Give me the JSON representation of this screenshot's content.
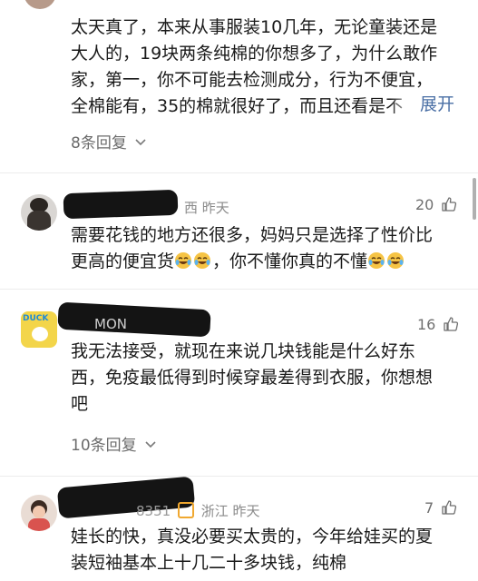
{
  "comment0": {
    "lines": [
      "太天真了，本来从事服装10几年，无论童装还是",
      "大人的，19块两条纯棉的你想多了，为什么敢作",
      "家，第一，你不可能去检测成分，行为不便宜，",
      "全棉能有，35的棉就很好了，而且还看是不"
    ],
    "expand_label": "展开",
    "replies_label": "8条回复"
  },
  "comment1": {
    "meta": "西 昨天",
    "likes": "20",
    "line1": "需要花钱的地方还很多，妈妈只是选择了性价比",
    "line2a": "更高的便宜货",
    "line2b": "，你不懂你真的不懂"
  },
  "comment2": {
    "avatar_text": "DUCK",
    "meta": "MON",
    "likes": "16",
    "lines": [
      "我无法接受，就现在来说几块钱能是什么好东",
      "西，免疫最低得到时候穿最差得到衣服，你想想",
      "吧"
    ],
    "replies_label": "10条回复"
  },
  "comment3": {
    "meta": "8351",
    "location_time": "浙江 昨天",
    "likes": "7",
    "lines": [
      "娃长的快，真没必要买太贵的，今年给娃买的夏",
      "装短袖基本上十几二十多块钱，纯棉"
    ]
  },
  "icons": {
    "thumb": "thumbs-up-icon",
    "chevron": "chevron-down-icon",
    "emoji": "laughing-crying-emoji"
  }
}
